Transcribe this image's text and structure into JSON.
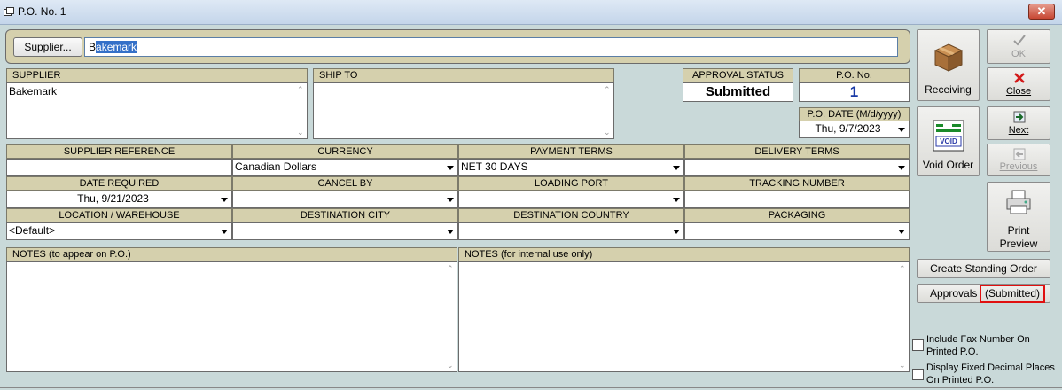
{
  "window": {
    "title": "P.O. No. 1",
    "close_glyph": "✕"
  },
  "supplier_bar": {
    "button_label": "Supplier...",
    "value_prefix": "B",
    "value_selected": "akemark"
  },
  "supplier": {
    "header": "SUPPLIER",
    "text": "Bakemark"
  },
  "ship_to": {
    "header": "SHIP TO",
    "text": ""
  },
  "approval": {
    "header": "APPROVAL STATUS",
    "value": "Submitted"
  },
  "po_no": {
    "header": "P.O. No.",
    "value": "1",
    "color": "#1a3aa6"
  },
  "po_date": {
    "header": "P.O. DATE (M/d/yyyy)",
    "value": "Thu, 9/7/2023"
  },
  "row1": {
    "supplier_reference": {
      "header": "SUPPLIER REFERENCE",
      "value": ""
    },
    "currency": {
      "header": "CURRENCY",
      "value": "Canadian Dollars"
    },
    "payment_terms": {
      "header": "PAYMENT TERMS",
      "value": "NET 30 DAYS"
    },
    "delivery_terms": {
      "header": "DELIVERY TERMS",
      "value": ""
    }
  },
  "row2": {
    "date_required": {
      "header": "DATE REQUIRED",
      "value": "Thu, 9/21/2023"
    },
    "cancel_by": {
      "header": "CANCEL BY",
      "value": ""
    },
    "loading_port": {
      "header": "LOADING PORT",
      "value": ""
    },
    "tracking_number": {
      "header": "TRACKING NUMBER",
      "value": ""
    }
  },
  "row3": {
    "location": {
      "header": "LOCATION / WAREHOUSE",
      "value": "<Default>"
    },
    "destination_city": {
      "header": "DESTINATION CITY",
      "value": ""
    },
    "destination_country": {
      "header": "DESTINATION COUNTRY",
      "value": ""
    },
    "packaging": {
      "header": "PACKAGING",
      "value": ""
    }
  },
  "notes": {
    "public_header": "NOTES (to appear on P.O.)",
    "internal_header": "NOTES (for internal use only)"
  },
  "buttons": {
    "receiving": "Receiving",
    "void_order": "Void Order",
    "void_icon_text": "VOID",
    "ok": "OK",
    "close": "Close",
    "next": "Next",
    "previous": "Previous",
    "print_preview_line1": "Print",
    "print_preview_line2": "Preview",
    "create_standing_order": "Create Standing Order",
    "approvals": "Approvals",
    "approvals_status": "(Submitted)"
  },
  "options": {
    "include_fax": "Include Fax Number On Printed P.O.",
    "fixed_decimals": "Display Fixed Decimal Places On Printed P.O."
  },
  "colors": {
    "header_bg": "#d5d0ad",
    "window_bg": "#c9d9d9",
    "highlight_red": "#e01010",
    "selection_blue": "#3470c8"
  }
}
